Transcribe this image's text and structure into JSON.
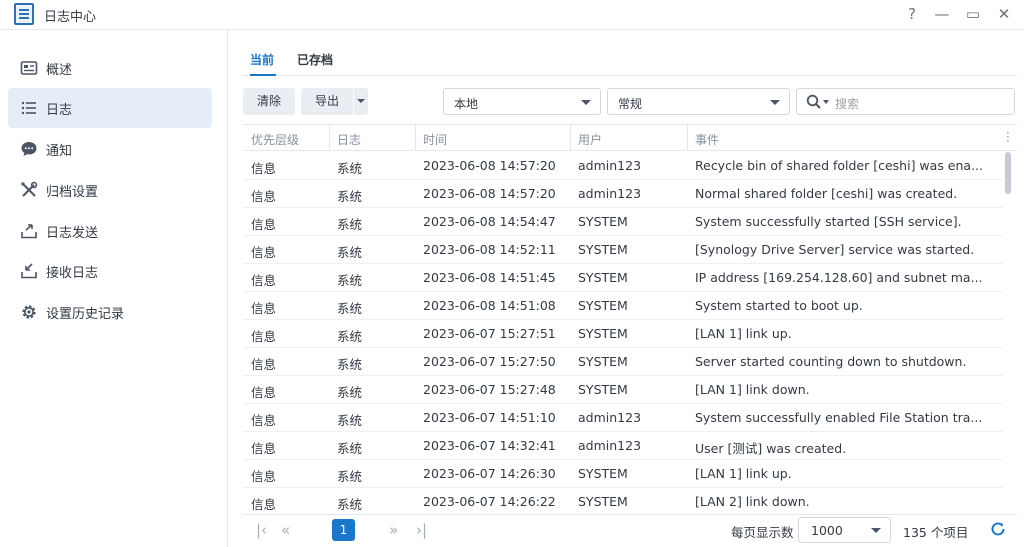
{
  "window": {
    "title": "日志中心",
    "controls": [
      "?",
      "—",
      "▭",
      "✕"
    ]
  },
  "sidebar": {
    "items": [
      {
        "label": "概述",
        "icon": "overview-icon",
        "active": false
      },
      {
        "label": "日志",
        "icon": "log-list-icon",
        "active": true
      },
      {
        "label": "通知",
        "icon": "chat-bubble-icon",
        "active": false
      },
      {
        "label": "归档设置",
        "icon": "tools-icon",
        "active": false
      },
      {
        "label": "日志发送",
        "icon": "upload-icon",
        "active": false
      },
      {
        "label": "接收日志",
        "icon": "download-icon",
        "active": false
      },
      {
        "label": "设置历史记录",
        "icon": "gear-icon",
        "active": false
      }
    ]
  },
  "tabs": [
    {
      "label": "当前",
      "active": true
    },
    {
      "label": "已存档",
      "active": false
    }
  ],
  "toolbar": {
    "clear_label": "清除",
    "export_label": "导出",
    "source_value": "本地",
    "type_value": "常规",
    "search_placeholder": "搜索"
  },
  "table": {
    "columns": [
      "优先层级",
      "日志",
      "时间",
      "用户",
      "事件"
    ],
    "rows": [
      {
        "level": "信息",
        "log": "系统",
        "time": "2023-06-08 14:57:20",
        "user": "admin123",
        "event": "Recycle bin of shared folder [ceshi] was ena..."
      },
      {
        "level": "信息",
        "log": "系统",
        "time": "2023-06-08 14:57:20",
        "user": "admin123",
        "event": "Normal shared folder [ceshi] was created."
      },
      {
        "level": "信息",
        "log": "系统",
        "time": "2023-06-08 14:54:47",
        "user": "SYSTEM",
        "event": "System successfully started [SSH service]."
      },
      {
        "level": "信息",
        "log": "系统",
        "time": "2023-06-08 14:52:11",
        "user": "SYSTEM",
        "event": "[Synology Drive Server] service was started."
      },
      {
        "level": "信息",
        "log": "系统",
        "time": "2023-06-08 14:51:45",
        "user": "SYSTEM",
        "event": "IP address [169.254.128.60] and subnet ma..."
      },
      {
        "level": "信息",
        "log": "系统",
        "time": "2023-06-08 14:51:08",
        "user": "SYSTEM",
        "event": "System started to boot up."
      },
      {
        "level": "信息",
        "log": "系统",
        "time": "2023-06-07 15:27:51",
        "user": "SYSTEM",
        "event": "[LAN 1] link up."
      },
      {
        "level": "信息",
        "log": "系统",
        "time": "2023-06-07 15:27:50",
        "user": "SYSTEM",
        "event": "Server started counting down to shutdown."
      },
      {
        "level": "信息",
        "log": "系统",
        "time": "2023-06-07 15:27:48",
        "user": "SYSTEM",
        "event": "[LAN 1] link down."
      },
      {
        "level": "信息",
        "log": "系统",
        "time": "2023-06-07 14:51:10",
        "user": "admin123",
        "event": "System successfully enabled File Station tra..."
      },
      {
        "level": "信息",
        "log": "系统",
        "time": "2023-06-07 14:32:41",
        "user": "admin123",
        "event": "User [测试] was created."
      },
      {
        "level": "信息",
        "log": "系统",
        "time": "2023-06-07 14:26:30",
        "user": "SYSTEM",
        "event": "[LAN 1] link up."
      },
      {
        "level": "信息",
        "log": "系统",
        "time": "2023-06-07 14:26:22",
        "user": "SYSTEM",
        "event": "[LAN 2] link down."
      }
    ]
  },
  "pagination": {
    "current_page": "1",
    "per_page_label": "每页显示数",
    "per_page_value": "1000",
    "total": "135 个项目"
  },
  "colors": {
    "accent": "#1a77c9",
    "active_bg": "#e5eef8"
  }
}
